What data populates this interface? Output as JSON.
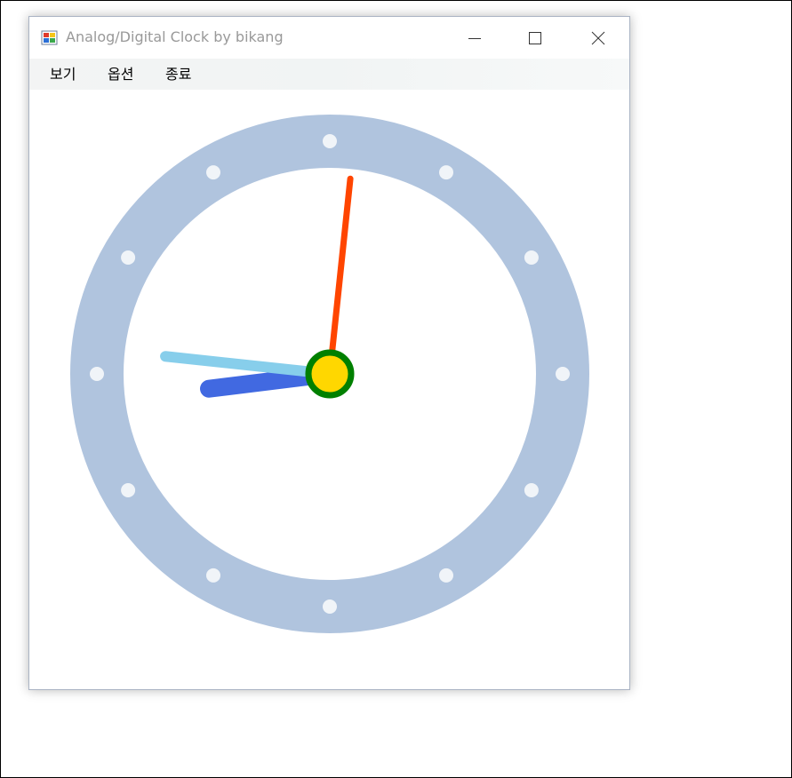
{
  "window": {
    "title": "Analog/Digital Clock by bikang",
    "icon": "windows-forms-app-icon",
    "controls": {
      "minimize_icon": "minimize-icon",
      "maximize_icon": "maximize-icon",
      "close_icon": "close-icon"
    }
  },
  "menu": {
    "items": [
      {
        "label": "보기"
      },
      {
        "label": "옵션"
      },
      {
        "label": "종료"
      }
    ]
  },
  "clock": {
    "type": "analog",
    "time": {
      "hour": 8,
      "minute": 46,
      "second": 1
    },
    "colors": {
      "ring": "#b0c4de",
      "ring_markers": "#f0f4f8",
      "face": "#ffffff",
      "hour_hand": "#4169e1",
      "minute_hand": "#87ceeb",
      "second_hand": "#ff4500",
      "center_fill": "#ffd700",
      "center_stroke": "#008000"
    }
  }
}
